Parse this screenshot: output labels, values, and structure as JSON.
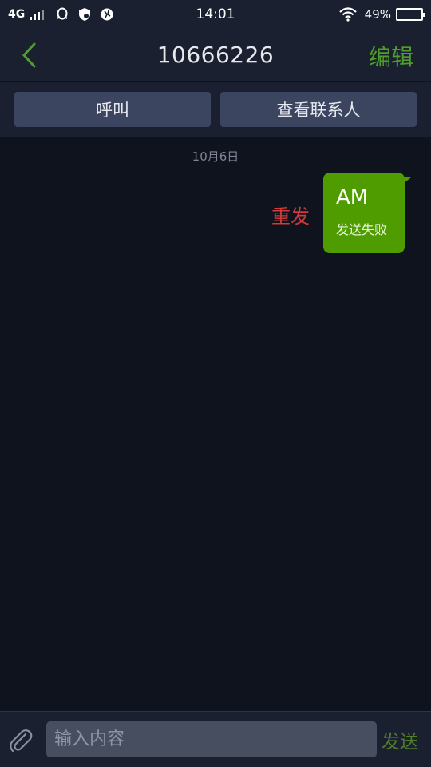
{
  "status_bar": {
    "network": "4G",
    "time": "14:01",
    "battery": "49%",
    "battery_level": 0.49,
    "icons": [
      "signal-icon",
      "qq-icon",
      "shield-icon",
      "browser-icon",
      "wifi-icon",
      "battery-icon"
    ]
  },
  "header": {
    "title": "10666226",
    "edit_label": "编辑",
    "back_icon": "chevron-left-icon"
  },
  "actions": {
    "call_label": "呼叫",
    "view_contact_label": "查看联系人"
  },
  "conversation": {
    "date": "10月6日",
    "messages": [
      {
        "text": "AM",
        "status": "发送失败",
        "resend_label": "重发"
      }
    ]
  },
  "composer": {
    "placeholder": "输入内容",
    "value": "",
    "send_label": "发送",
    "attach_icon": "paperclip-icon"
  },
  "colors": {
    "accent": "#4f9d2a",
    "bubble": "#4e9c00",
    "error": "#d03a3a",
    "background": "#0f131d",
    "bar": "#1a2030"
  }
}
